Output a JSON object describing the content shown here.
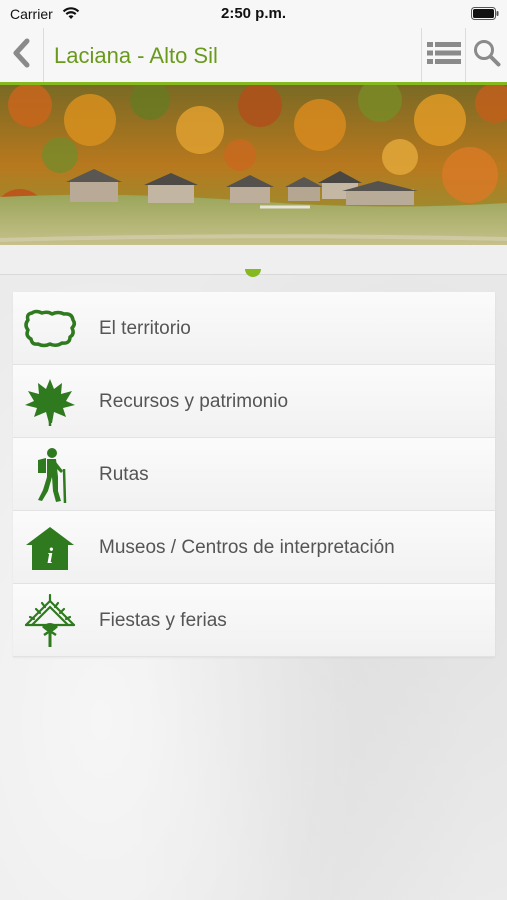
{
  "status_bar": {
    "carrier": "Carrier",
    "time": "2:50 p.m."
  },
  "nav": {
    "title": "Laciana - Alto Sil",
    "accent_color": "#86b820",
    "title_color": "#6a9a1c"
  },
  "menu": {
    "icon_color": "#2f7a1f",
    "items": [
      {
        "label": "El territorio",
        "icon": "territory-map-icon"
      },
      {
        "label": "Recursos y patrimonio",
        "icon": "leaf-icon"
      },
      {
        "label": "Rutas",
        "icon": "hiker-icon"
      },
      {
        "label": "Museos / Centros de interpretación",
        "icon": "info-house-icon"
      },
      {
        "label": "Fiestas y ferias",
        "icon": "festival-arch-icon"
      }
    ]
  }
}
